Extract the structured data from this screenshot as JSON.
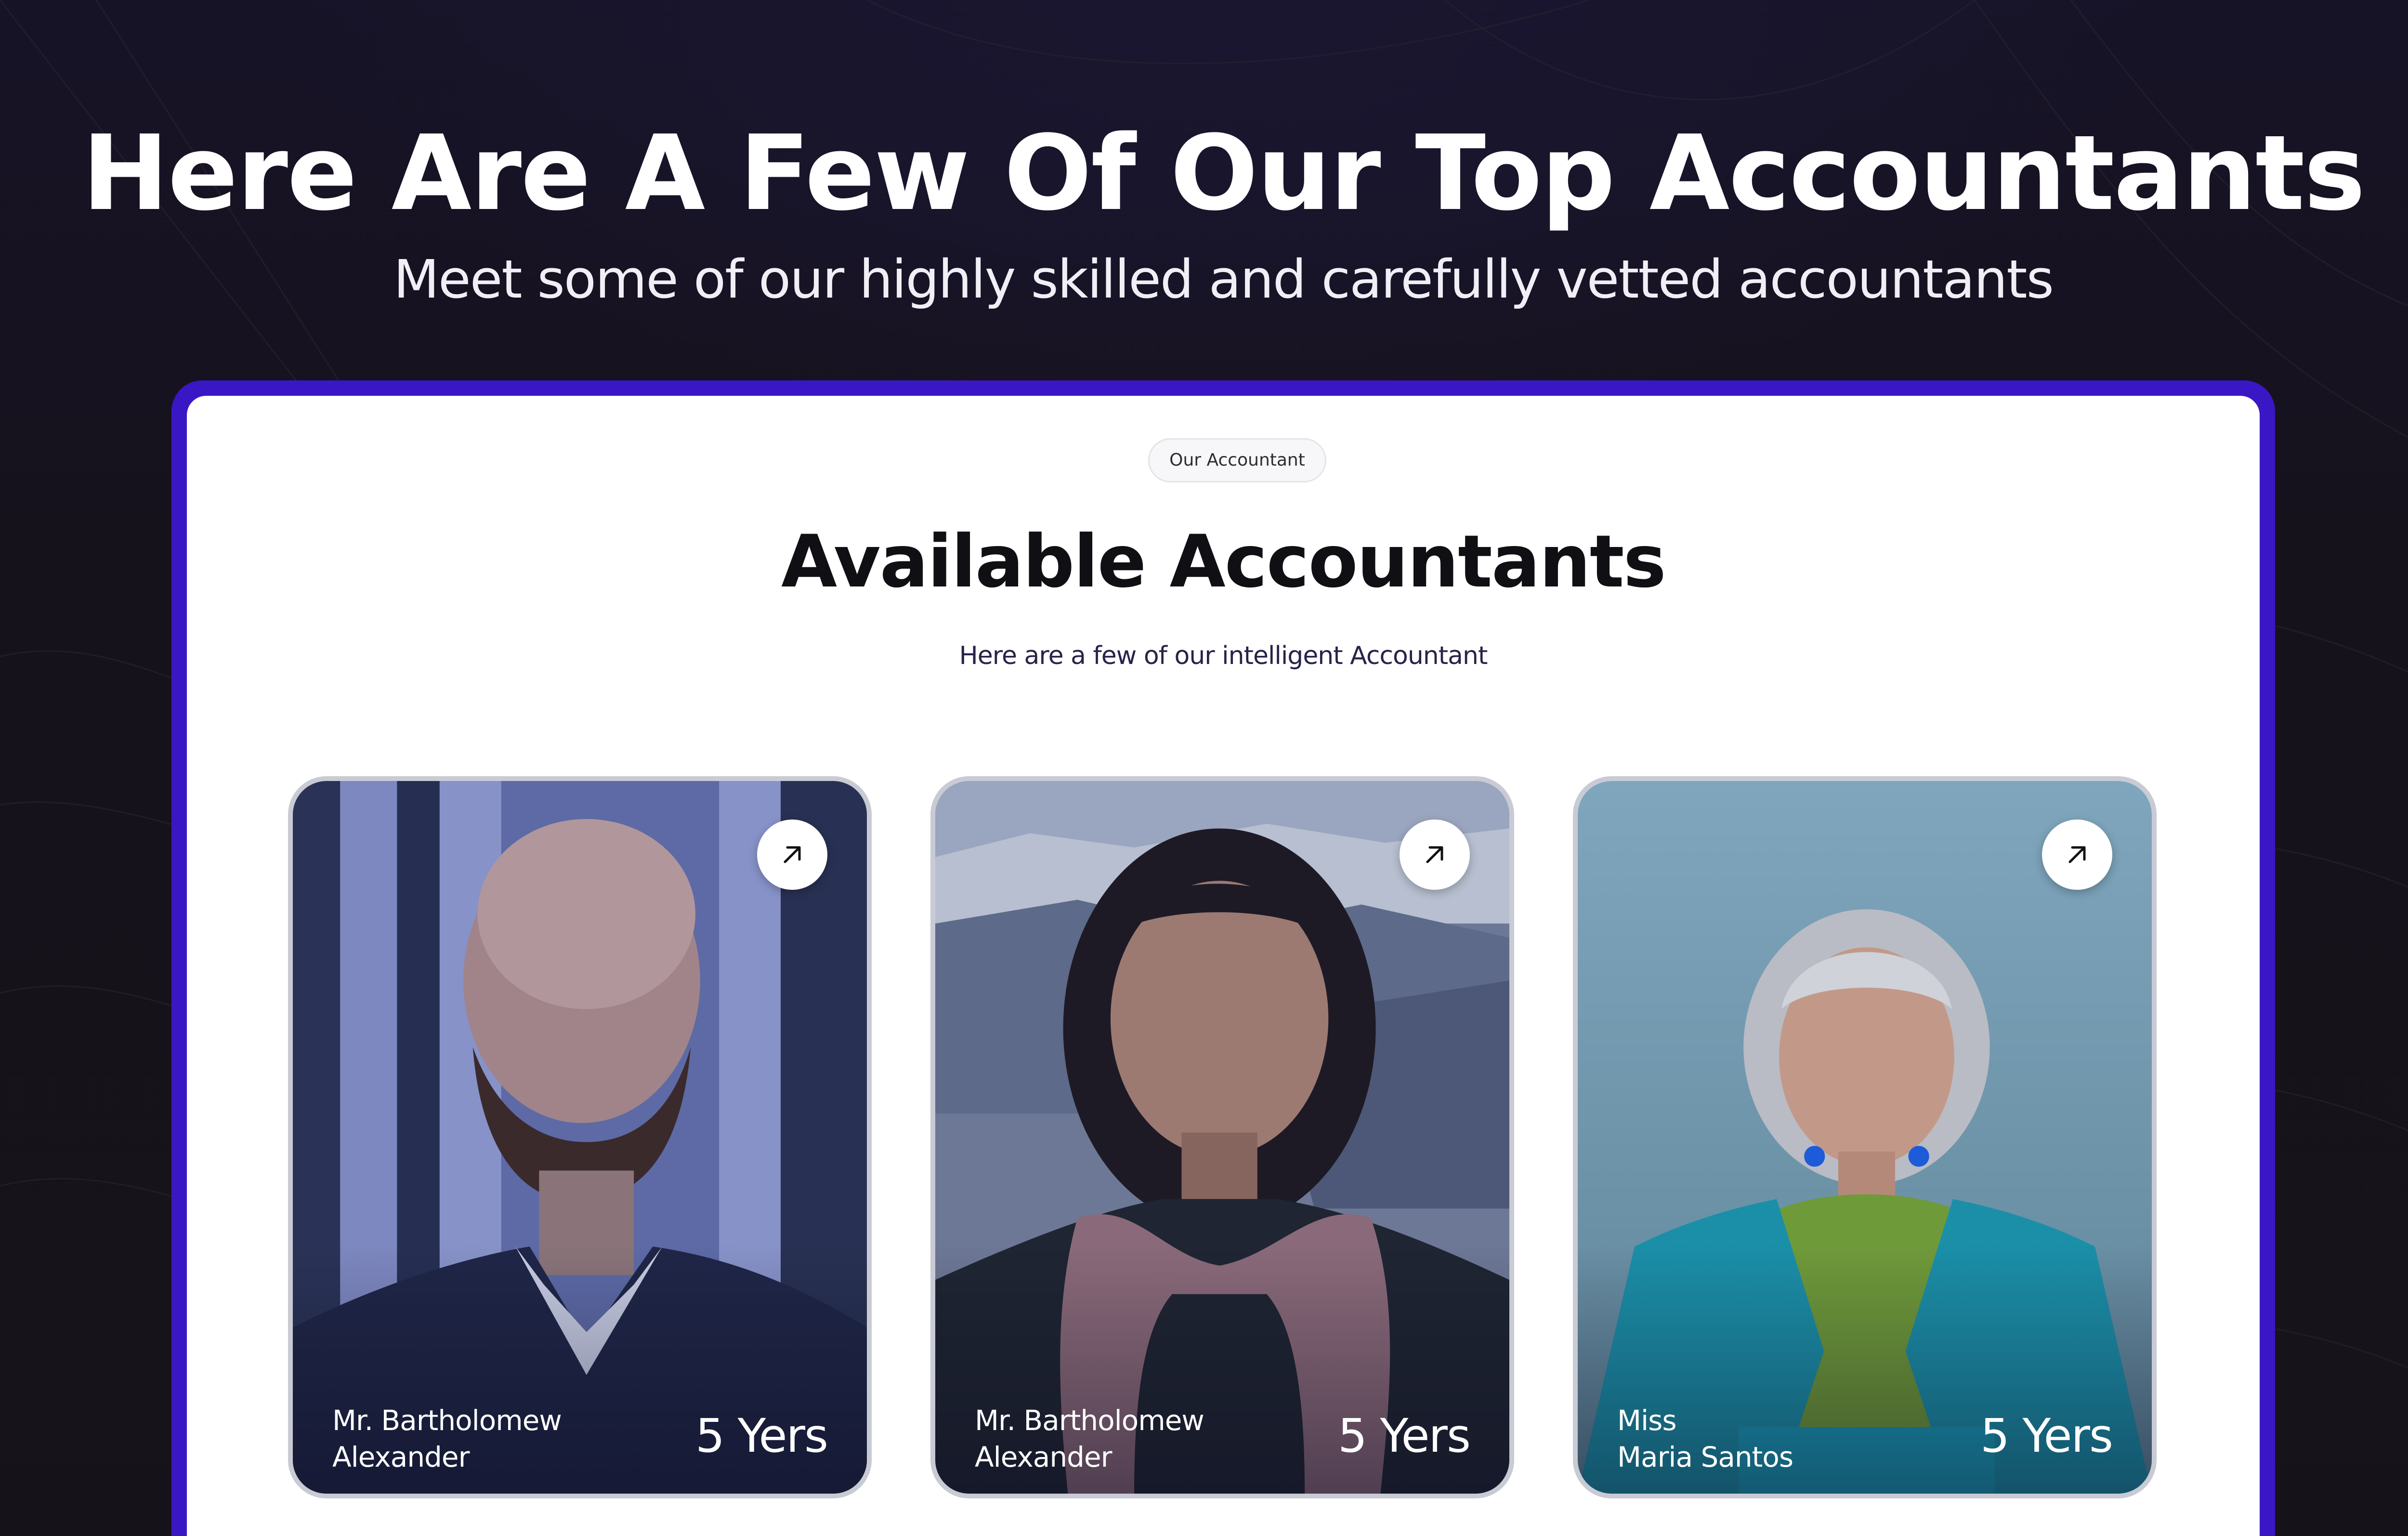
{
  "hero": {
    "title": "Here Are A Few Of Our Top Accountants",
    "subtitle": "Meet some of our highly skilled and carefully vetted accountants"
  },
  "section": {
    "badge": "Our Accountant",
    "title": "Available Accountants",
    "description": "Here are a few of our intelligent Accountant"
  },
  "cards": [
    {
      "name_line1": "Mr. Bartholomew",
      "name_line2": "Alexander",
      "experience": "5 Yers",
      "icon": "arrow-up-right-icon"
    },
    {
      "name_line1": "Mr. Bartholomew",
      "name_line2": "Alexander",
      "experience": "5 Yers",
      "icon": "arrow-up-right-icon"
    },
    {
      "name_line1": "Miss",
      "name_line2": "Maria Santos",
      "experience": "5 Yers",
      "icon": "arrow-up-right-icon"
    }
  ],
  "colors": {
    "background": "#16121a",
    "frame_accent": "#3a17c4",
    "panel": "#ffffff",
    "card_border": "#c9cbd4"
  }
}
